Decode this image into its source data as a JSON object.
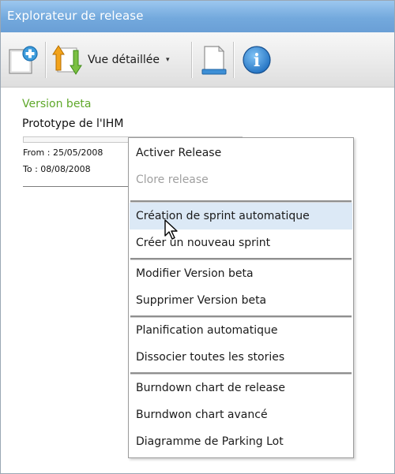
{
  "window": {
    "title": "Explorateur de release"
  },
  "toolbar": {
    "new_icon": "add-document-icon",
    "view_icon": "sort-arrows-icon",
    "view_label": "Vue détaillée",
    "view_caret": "▾",
    "print_icon": "document-icon",
    "info_icon": "info-icon",
    "info_glyph": "i"
  },
  "release": {
    "name": "Version beta",
    "description": "Prototype de l'IHM",
    "progress": 0.0,
    "from": "From : 25/05/2008",
    "to": "To : 08/08/2008"
  },
  "menu": {
    "items": [
      {
        "label": "Activer Release",
        "enabled": true
      },
      {
        "label": "Clore release",
        "enabled": false
      },
      {
        "label": "Création de sprint automatique",
        "enabled": true,
        "hovered": true
      },
      {
        "label": "Créer un nouveau sprint",
        "enabled": true
      },
      {
        "label": "Modifier Version beta",
        "enabled": true
      },
      {
        "label": "Supprimer Version beta",
        "enabled": true
      },
      {
        "label": "Planification automatique",
        "enabled": true
      },
      {
        "label": "Dissocier toutes les stories",
        "enabled": true
      },
      {
        "label": "Burndown chart de release",
        "enabled": true
      },
      {
        "label": "Burndwon chart avancé",
        "enabled": true
      },
      {
        "label": "Diagramme de Parking Lot",
        "enabled": true
      }
    ]
  },
  "colors": {
    "titlebar": "#73a9dd",
    "release_name": "#5fa82a",
    "hover": "#dce9f6",
    "disabled": "#a0a0a0"
  }
}
